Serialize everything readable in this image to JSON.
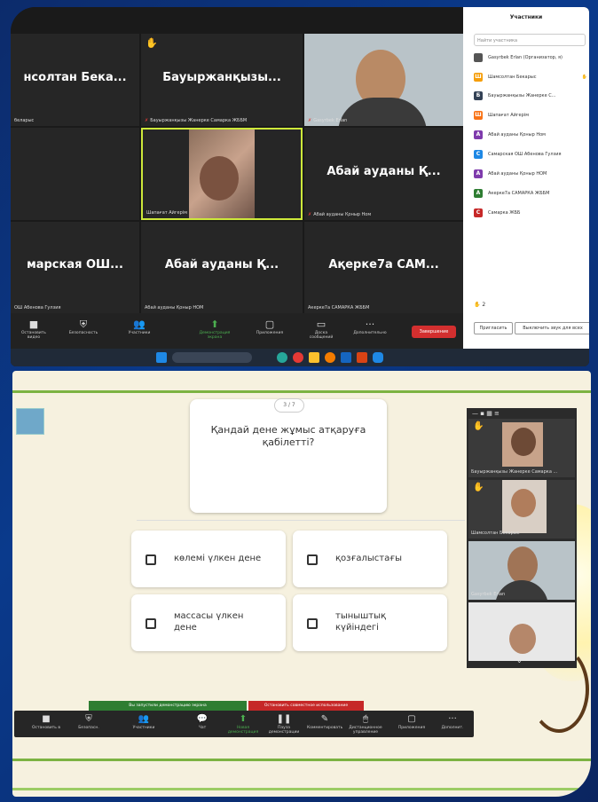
{
  "top": {
    "tiles": [
      {
        "name": "нсолтан Бека...",
        "caption": "беларыс"
      },
      {
        "name": "Бауыржанқызы...",
        "caption": "Бауыржанқызы Жанерке Самарка ЖББМ"
      },
      {
        "name": "",
        "caption": "Gasyrbek Erlan"
      },
      {
        "name": "",
        "caption": ""
      },
      {
        "name": "",
        "caption": "Шапағат Айгерім"
      },
      {
        "name": "Абай ауданы Қ...",
        "caption": "Абай ауданы Қоныр Ном"
      },
      {
        "name": "марская ОШ...",
        "caption": "ОШ Абенова Гулзия"
      },
      {
        "name": "Абай ауданы Қ...",
        "caption": "Абай ауданы Қоныр НОМ"
      },
      {
        "name": "Ақерке7а САМ...",
        "caption": "Акерке7а САМАРКА ЖББМ"
      }
    ],
    "toolbar": [
      "Остановить видео",
      "Безопасность",
      "Участники",
      "Демонстрация экрана",
      "Приложения",
      "Доска сообщений",
      "Дополнительно"
    ],
    "end_label": "Завершение",
    "panel": {
      "title": "Участники",
      "search_placeholder": "Найти участника",
      "participants": [
        {
          "initial": "",
          "name": "Gasyrbek Erlan (Организатор, я)",
          "color": "#555555"
        },
        {
          "initial": "Ш",
          "name": "Шамсолтан Бекарыс",
          "color": "#f59e0b"
        },
        {
          "initial": "Б",
          "name": "Бауыржанқызы Жанерке С...",
          "color": "#334155"
        },
        {
          "initial": "Ш",
          "name": "Шапағат Айгерім",
          "color": "#f97316"
        },
        {
          "initial": "А",
          "name": "Абай ауданы Қоныр Ном",
          "color": "#7e3aac"
        },
        {
          "initial": "С",
          "name": "Самарская ОШ Абенова Гулзия",
          "color": "#1e88e5"
        },
        {
          "initial": "А",
          "name": "Абай ауданы Қоныр НОМ",
          "color": "#7e3aac"
        },
        {
          "initial": "А",
          "name": "Акерке7а САМАРКА ЖББМ",
          "color": "#2e7d32"
        },
        {
          "initial": "С",
          "name": "Самарка ЖББ",
          "color": "#c62828"
        }
      ],
      "hands_count": "2",
      "invite_label": "Пригласить",
      "mute_label": "Выключить звук для всех"
    }
  },
  "bottom": {
    "counter": "3 / 7",
    "question": "Қандай дене жұмыс атқаруға қабілетті?",
    "options": [
      "көлемі үлкен дене",
      "қозғалыстағы",
      "массасы үлкен дене",
      "тыныштық күйіндегі"
    ],
    "video_tiles": [
      {
        "caption": "Бауыржанқызы Жанерке Самарка ..."
      },
      {
        "caption": "Шамсолтан Бекарыс"
      },
      {
        "caption": "Gasyrbek Erlan"
      },
      {
        "caption": ""
      }
    ],
    "share_on": "Вы запустили демонстрацию экрана",
    "share_stop": "Остановить совместное использование",
    "toolbar": [
      "Остановить в",
      "Безопасн.",
      "Участники",
      "Чат",
      "Новая демонстрация",
      "Пауза демонстрации",
      "Комментировать",
      "Дистанционное управление",
      "Приложения",
      "Дополнит."
    ]
  }
}
